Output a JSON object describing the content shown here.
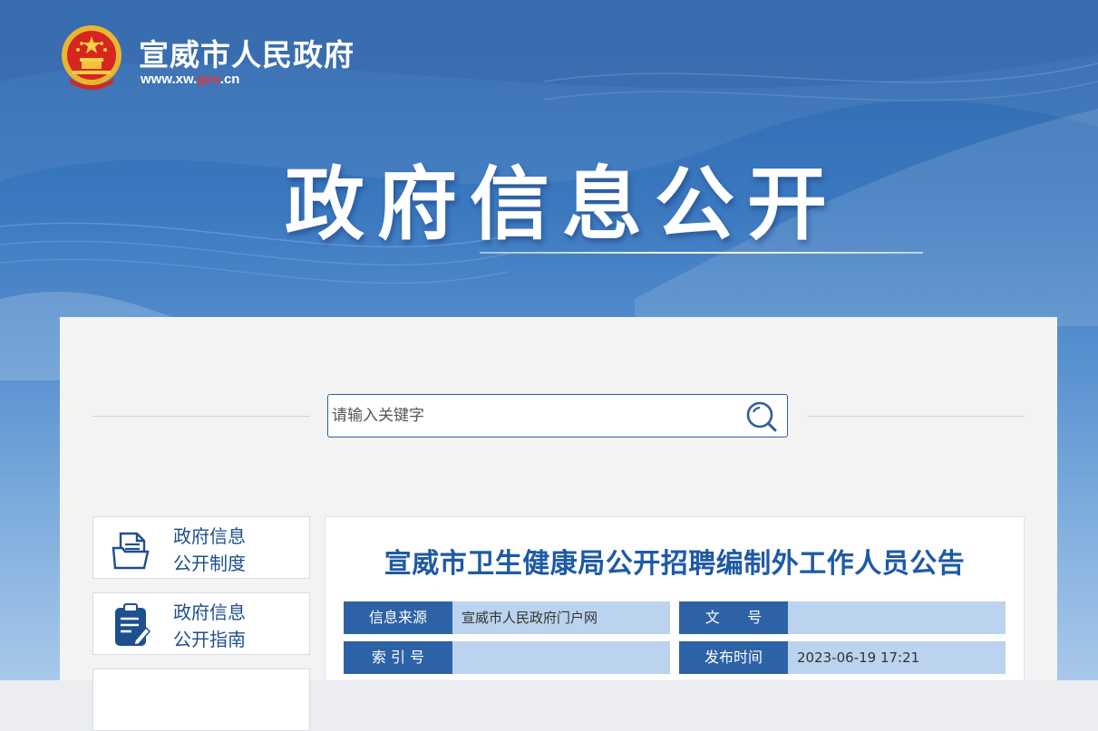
{
  "header": {
    "site_name": "宣威市人民政府",
    "url_prefix": "www.xw.",
    "url_gov": "gov",
    "url_suffix": ".cn",
    "emblem_icon": "national-emblem-icon"
  },
  "banner": {
    "title": "政府信息公开"
  },
  "search": {
    "placeholder": "请输入关键字",
    "value": "",
    "icon": "search-icon"
  },
  "sidebar": {
    "items": [
      {
        "line1": "政府信息",
        "line2": "公开制度",
        "icon": "document-stack-icon"
      },
      {
        "line1": "政府信息",
        "line2": "公开指南",
        "icon": "clipboard-edit-icon"
      }
    ]
  },
  "article": {
    "title": "宣威市卫生健康局公开招聘编制外工作人员公告",
    "meta": {
      "source_label": "信息来源",
      "source_value": "宣威市人民政府门户网",
      "doc_no_label": "文      号",
      "doc_no_value": "",
      "index_label": "索 引 号",
      "index_value": "",
      "publish_label": "发布时间",
      "publish_value": "2023-06-19 17:21"
    }
  },
  "colors": {
    "brand_blue": "#2d62a6",
    "meta_value_bg": "#bcd3ef",
    "title_blue": "#1e5aa6",
    "url_red": "#e0363a"
  }
}
